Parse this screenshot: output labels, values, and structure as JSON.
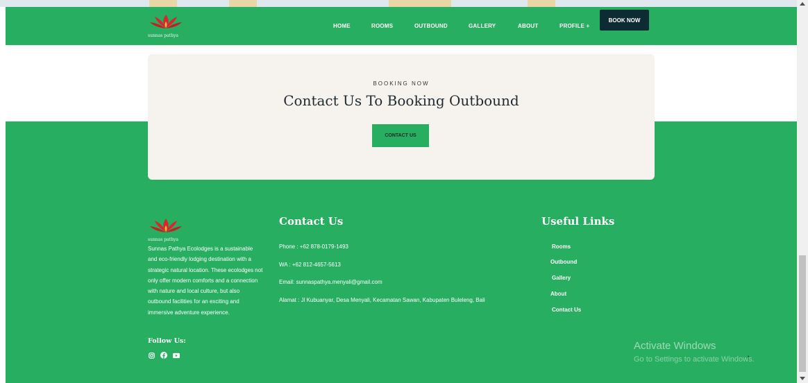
{
  "brand": {
    "logo_text": "sunnas pathya"
  },
  "nav": {
    "items": [
      "HOME",
      "ROOMS",
      "OUTBOUND",
      "GALLERY",
      "ABOUT",
      "PROFILE +"
    ],
    "book_now": "BOOK NOW"
  },
  "cta": {
    "eyebrow": "BOOKING NOW",
    "title": "Contact Us To Booking Outbound",
    "button": "CONTACT US"
  },
  "footer": {
    "about": "Sunnas Pathya Ecolodges is a sustainable and eco-friendly lodging destination with a strategic natural location. These ecolodges not only offer modern comforts and a connection with nature and local culture, but also outbound facilities for an exciting and immersive adventure experience.",
    "follow_label": "Follow Us:",
    "social_icons": [
      "instagram-icon",
      "facebook-icon",
      "youtube-icon"
    ],
    "contact_heading": "Contact Us",
    "contact": [
      "Phone : +62 878-0179-1493",
      "WA : +62 812-4657-5613",
      "Email: sunnaspathya.menyali@gmail.com",
      "Alamat : Jl Kubuanyar, Desa Menyali, Kecamatan Sawan, Kabupaten Buleleng, Bali"
    ],
    "links_heading": "Useful Links",
    "links": [
      "Rooms",
      "Outbound",
      "Gallery",
      "About",
      "Contact Us"
    ]
  },
  "watermark": {
    "line1": "Activate Windows",
    "line2": "Go to Settings to activate Windows."
  },
  "colors": {
    "accent": "#27ae60",
    "dark": "#0c2b33",
    "card": "#f6f3ee"
  }
}
